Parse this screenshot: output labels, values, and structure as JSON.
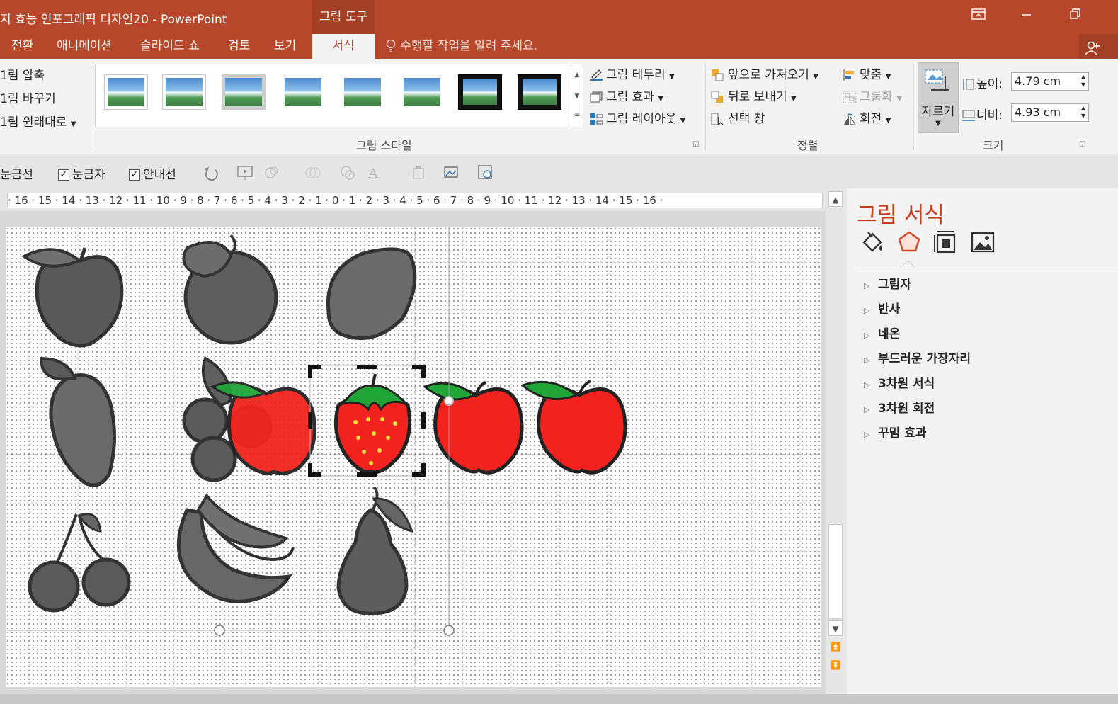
{
  "app": {
    "title": "지 효능 인포그래픽 디자인20 - PowerPoint",
    "contextual_tab": "그림 도구"
  },
  "window": {
    "restore_ribbon_icon": "ribbon-display-icon",
    "minimize_icon": "minimize-icon",
    "restore_icon": "restore-icon"
  },
  "tabs": [
    {
      "label": "전환"
    },
    {
      "label": "애니메이션"
    },
    {
      "label": "슬라이드 쇼"
    },
    {
      "label": "검토"
    },
    {
      "label": "보기"
    },
    {
      "label": "서식",
      "active": true
    }
  ],
  "tell_me": "수행할 작업을 알려 주세요.",
  "ribbon": {
    "adjust": {
      "compress": "1림 압축",
      "change": "1림 바꾸기",
      "reset": "1림 원래대로"
    },
    "styles": {
      "group_label": "그림 스타일",
      "border": "그림 테두리",
      "effects": "그림 효과",
      "layout": "그림 레이아웃"
    },
    "arrange": {
      "group_label": "정렬",
      "bring_forward": "앞으로 가져오기",
      "send_backward": "뒤로 보내기",
      "selection_pane": "선택 창",
      "align": "맞춤",
      "group": "그룹화",
      "rotate": "회전"
    },
    "size": {
      "group_label": "크기",
      "crop": "자르기",
      "height_label": "높이:",
      "height_value": "4.79 cm",
      "width_label": "너비:",
      "width_value": "4.93 cm"
    }
  },
  "view_toolbar": {
    "gridlines": "눈금선",
    "ruler": "눈금자",
    "guides": "안내선",
    "ruler_checked": true,
    "guides_checked": true
  },
  "ruler_text": "· 16 · 15 · 14 · 13 · 12 · 11 · 10 · 9 · 8 · 7 · 6 · 5 · 4 · 3 · 2 · 1 · 0 · 1 · 2 · 3 · 4 · 5 · 6 · 7 · 8 · 9 · 10 · 11 · 12 · 13 · 14 · 15 · 16 ·",
  "pane": {
    "title": "그림 서식",
    "icons": [
      "fill-line-icon",
      "effects-pentagon-icon",
      "size-properties-icon",
      "picture-icon"
    ],
    "items": [
      {
        "label": "그림자"
      },
      {
        "label": "반사"
      },
      {
        "label": "네온"
      },
      {
        "label": "부드러운 가장자리"
      },
      {
        "label": "3차원 서식"
      },
      {
        "label": "3차원 회전"
      },
      {
        "label": "꾸밈 효과"
      }
    ]
  },
  "colors": {
    "brand": "#b7472a",
    "pane_title": "#c43e1c",
    "fruit_red": "#f2231e",
    "leaf_green": "#20a536",
    "fruit_gray": "#555555"
  }
}
